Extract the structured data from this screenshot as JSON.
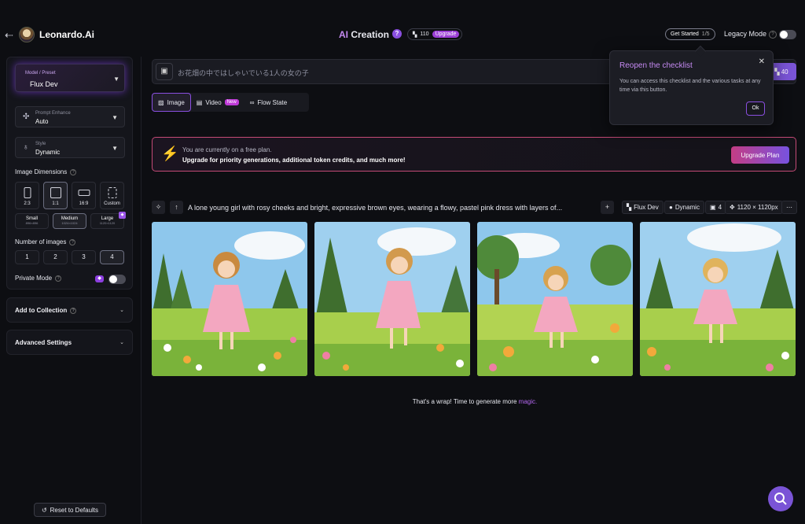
{
  "header": {
    "brand": "Leonardo.Ai",
    "title_ai": "AI",
    "title_rest": " Creation",
    "help": "?",
    "tokens": "110",
    "upgrade": "Upgrade",
    "get_started": "Get Started",
    "get_started_progress": "1/5",
    "legacy_mode": "Legacy Mode"
  },
  "sidebar": {
    "preset_label": "Model / Preset",
    "preset_value": "Flux Dev",
    "prompt_enhance_label": "Prompt Enhance",
    "prompt_enhance_value": "Auto",
    "style_label": "Style",
    "style_value": "Dynamic",
    "image_dimensions": "Image Dimensions",
    "ratios": [
      "2:3",
      "1:1",
      "16:9",
      "Custom"
    ],
    "sizes": [
      {
        "label": "Small",
        "dims": "896×896"
      },
      {
        "label": "Medium",
        "dims": "1024×1024"
      },
      {
        "label": "Large",
        "dims": "1120×1120"
      }
    ],
    "number_of_images": "Number of images",
    "counts": [
      "1",
      "2",
      "3",
      "4"
    ],
    "private_mode": "Private Mode",
    "add_to_collection": "Add to Collection",
    "advanced_settings": "Advanced Settings",
    "reset": "Reset to Defaults"
  },
  "main": {
    "prompt_placeholder": "お花畑の中ではしゃいでいる1人の女の子",
    "generate_count": "40",
    "modes": [
      "Image",
      "Video",
      "Flow State"
    ],
    "new_badge": "New",
    "banner_line1": "You are currently on a free plan.",
    "banner_line2": "Upgrade for priority generations, additional token credits, and much more!",
    "upgrade_plan": "Upgrade Plan",
    "generation_prompt": "A lone young girl with rosy cheeks and bright, expressive brown eyes, wearing a flowy, pastel pink dress with layers of...",
    "tag_model": "Flux Dev",
    "tag_style": "Dynamic",
    "tag_count": "4",
    "tag_size": "1120 × 1120px",
    "wrap_text": "That's a wrap! Time to generate more ",
    "wrap_magic": "magic."
  },
  "popover": {
    "title": "Reopen the checklist",
    "body": "You can access this checklist and the various tasks at any time via this button.",
    "ok": "Ok"
  },
  "colors": {
    "accent": "#8a4fe0",
    "background": "#0d0e12",
    "banner_border": "#c44a76"
  }
}
